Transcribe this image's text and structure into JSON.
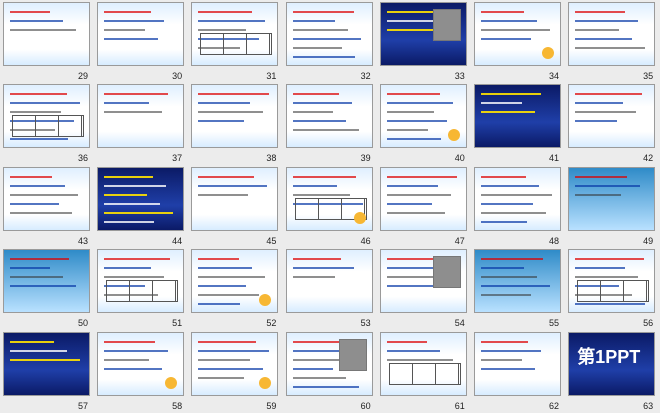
{
  "slides": [
    {
      "number": "29"
    },
    {
      "number": "30"
    },
    {
      "number": "31"
    },
    {
      "number": "32"
    },
    {
      "number": "33"
    },
    {
      "number": "34"
    },
    {
      "number": "35"
    },
    {
      "number": "36"
    },
    {
      "number": "37"
    },
    {
      "number": "38"
    },
    {
      "number": "39"
    },
    {
      "number": "40"
    },
    {
      "number": "41"
    },
    {
      "number": "42"
    },
    {
      "number": "43"
    },
    {
      "number": "44"
    },
    {
      "number": "45"
    },
    {
      "number": "46"
    },
    {
      "number": "47"
    },
    {
      "number": "48"
    },
    {
      "number": "49"
    },
    {
      "number": "50"
    },
    {
      "number": "51"
    },
    {
      "number": "52"
    },
    {
      "number": "53"
    },
    {
      "number": "54"
    },
    {
      "number": "55"
    },
    {
      "number": "56"
    },
    {
      "number": "57"
    },
    {
      "number": "58"
    },
    {
      "number": "59"
    },
    {
      "number": "60"
    },
    {
      "number": "61"
    },
    {
      "number": "62"
    },
    {
      "number": "63"
    }
  ],
  "logo_text": "第1PPT",
  "colors": {
    "background": "#ececec",
    "thumb_border": "#9a9a9a",
    "accent_red": "#cc0000",
    "accent_blue": "#0a3aa8"
  }
}
